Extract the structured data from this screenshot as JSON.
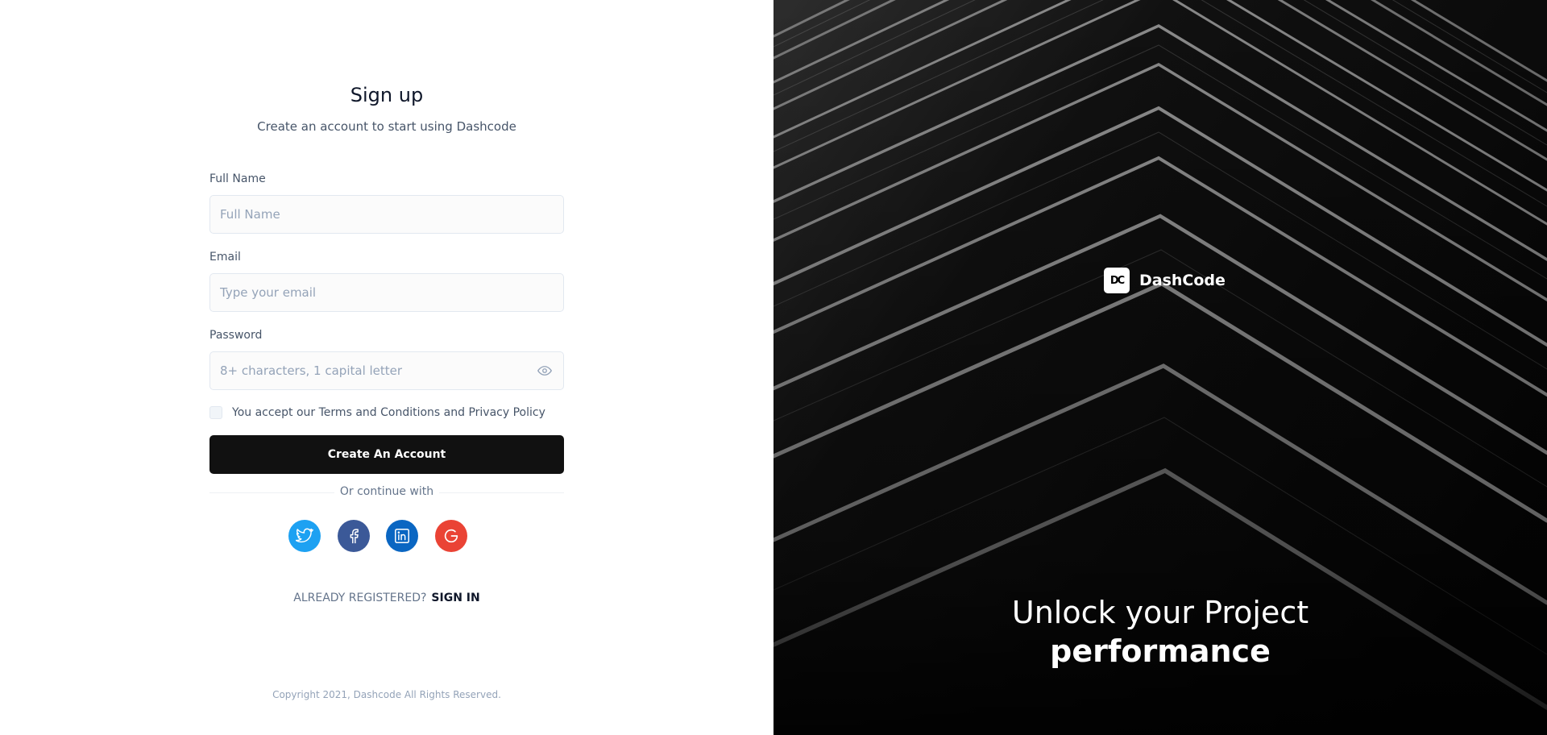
{
  "signup": {
    "title": "Sign up",
    "subtitle": "Create an account to start using Dashcode",
    "full_name": {
      "label": "Full Name",
      "placeholder": "Full Name",
      "value": ""
    },
    "email": {
      "label": "Email",
      "placeholder": "Type your email",
      "value": ""
    },
    "password": {
      "label": "Password",
      "placeholder": "8+ characters, 1 capital letter",
      "value": ""
    },
    "terms_text": "You accept our Terms and Conditions and Privacy Policy",
    "create_button": "Create An Account",
    "divider_text": "Or continue with",
    "socials": [
      {
        "name": "twitter",
        "icon": "twitter-icon",
        "color": "#1da1f2"
      },
      {
        "name": "facebook",
        "icon": "facebook-icon",
        "color": "#3b5998"
      },
      {
        "name": "linkedin",
        "icon": "linkedin-icon",
        "color": "#0a66c2"
      },
      {
        "name": "google",
        "icon": "google-icon",
        "color": "#ea4335"
      }
    ],
    "already_registered": "ALREADY REGISTERED?",
    "sign_in": "SIGN IN",
    "copyright": "Copyright 2021, Dashcode All Rights Reserved."
  },
  "hero": {
    "logo_text": "DC",
    "brand": "DashCode",
    "tagline_line1": "Unlock your Project",
    "tagline_line2": "performance"
  },
  "colors": {
    "primary_button": "#111111",
    "hero_background": "#060606"
  }
}
